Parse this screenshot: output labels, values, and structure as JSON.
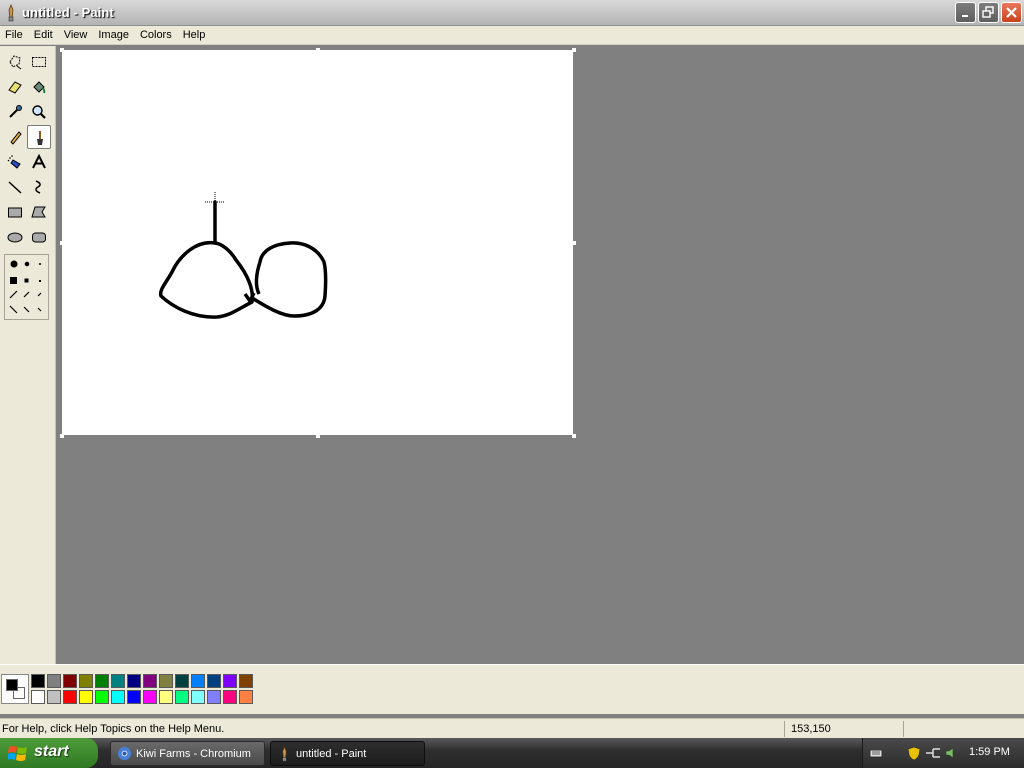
{
  "window": {
    "title": "untitled - Paint"
  },
  "menu": [
    "File",
    "Edit",
    "View",
    "Image",
    "Colors",
    "Help"
  ],
  "tools": [
    "free-form-select",
    "select",
    "eraser",
    "fill-with-color",
    "pick-color",
    "magnifier",
    "pencil",
    "brush",
    "airbrush",
    "text",
    "line",
    "curve",
    "rectangle",
    "polygon",
    "ellipse",
    "rounded-rectangle"
  ],
  "active_tool": "brush",
  "palette": {
    "foreground": "#000000",
    "background": "#ffffff",
    "row1": [
      "#000000",
      "#808080",
      "#800000",
      "#808000",
      "#008000",
      "#008080",
      "#000080",
      "#800080",
      "#808040",
      "#004040",
      "#0080ff",
      "#004080",
      "#8000ff",
      "#804000"
    ],
    "row2": [
      "#ffffff",
      "#c0c0c0",
      "#ff0000",
      "#ffff00",
      "#00ff00",
      "#00ffff",
      "#0000ff",
      "#ff00ff",
      "#ffff80",
      "#00ff80",
      "#80ffff",
      "#8080ff",
      "#ff0080",
      "#ff8040"
    ]
  },
  "status": {
    "help_text": "For Help, click Help Topics on the Help Menu.",
    "coordinates": "153,150"
  },
  "taskbar": {
    "start_label": "start",
    "tasks": [
      {
        "label": "Kiwi Farms - Chromium",
        "icon": "chromium-icon"
      },
      {
        "label": "untitled - Paint",
        "icon": "paint-icon"
      }
    ],
    "clock": "1:59 PM"
  }
}
